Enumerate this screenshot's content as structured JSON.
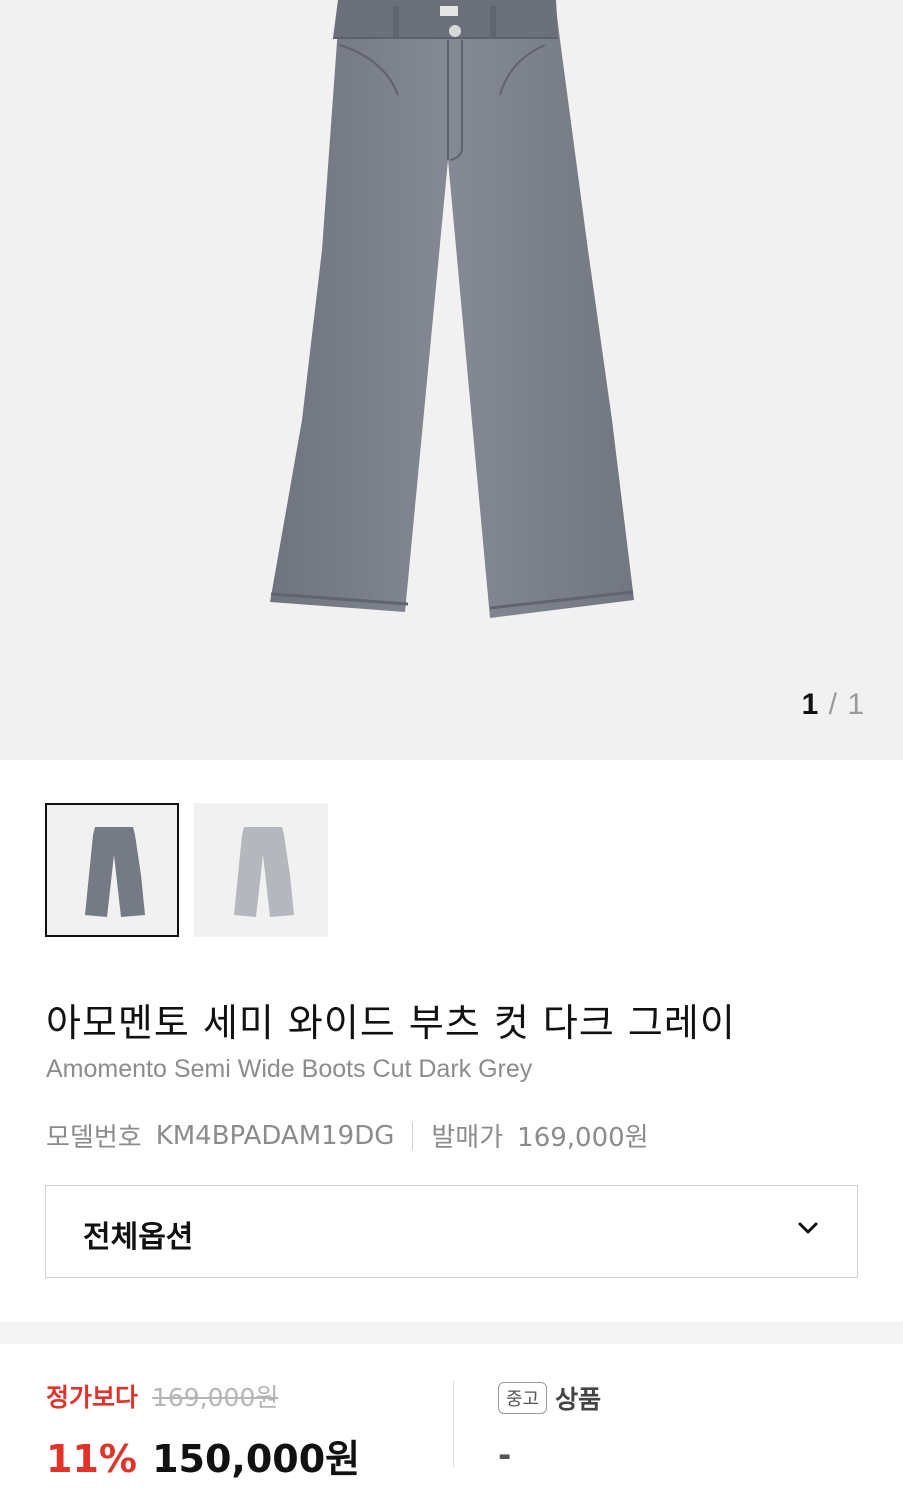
{
  "gallery": {
    "current_page": "1",
    "separator": "/",
    "total_pages": "1"
  },
  "thumbnails": [
    {
      "color_name": "dark grey",
      "selected": true
    },
    {
      "color_name": "light grey",
      "selected": false
    }
  ],
  "product": {
    "title_ko": "아모멘토 세미 와이드 부츠 컷 다크 그레이",
    "title_en": "Amomento Semi Wide Boots Cut Dark Grey",
    "model_label": "모델번호",
    "model_value": "KM4BPADAM19DG",
    "release_label": "발매가",
    "release_value": "169,000원"
  },
  "options": {
    "select_label": "전체옵션"
  },
  "pricing": {
    "compare_label": "정가보다",
    "original_price": "169,000원",
    "discount_percent": "11%",
    "sale_price": "150,000원"
  },
  "used": {
    "badge": "중고",
    "label": "상품",
    "value": "-"
  },
  "colors": {
    "accent_red": "#e0342a",
    "jean_dark": "#7b7f8a",
    "jean_light": "#b5b9be"
  }
}
